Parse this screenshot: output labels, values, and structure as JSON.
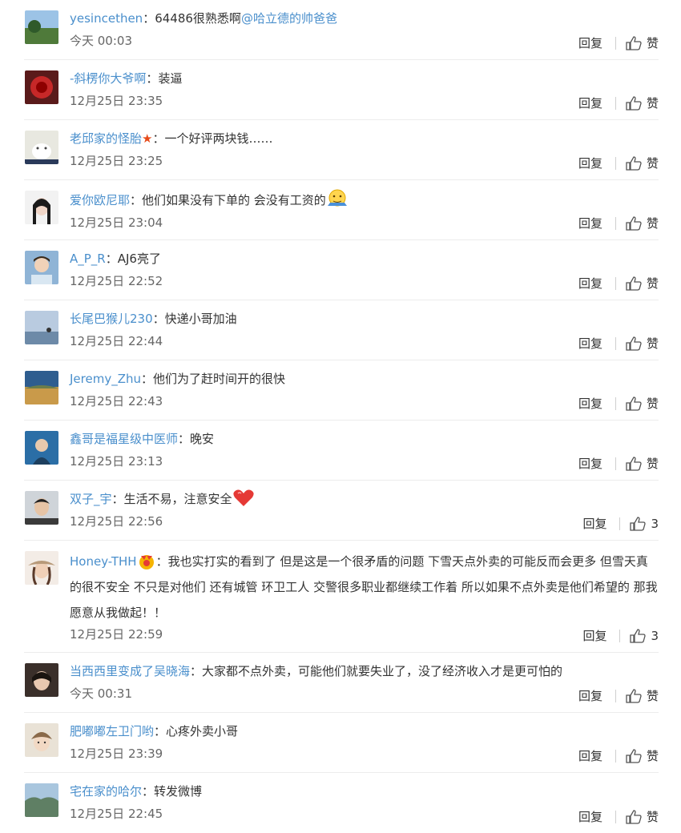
{
  "comments": [
    {
      "user": "yesincethen",
      "sep": "：",
      "text": "64486很熟悉啊",
      "mention": "@哈立德的帅爸爸",
      "time": "今天 00:03",
      "reply": "回复",
      "like": "赞"
    },
    {
      "user": "-斜楞你大爷啊",
      "sep": "：",
      "text": "装逼",
      "time": "12月25日 23:35",
      "reply": "回复",
      "like": "赞"
    },
    {
      "user": "老邱家的怪胎",
      "sep": "：",
      "text": "一个好评两块钱……",
      "time": "12月25日 23:25",
      "reply": "回复",
      "like": "赞",
      "badge": "★"
    },
    {
      "user": "爱你欧尼耶",
      "sep": "：",
      "text": "他们如果没有下单的 会没有工资的",
      "time": "12月25日 23:04",
      "reply": "回复",
      "like": "赞"
    },
    {
      "user": "A_P_R",
      "sep": "：",
      "text": "AJ6亮了",
      "time": "12月25日 22:52",
      "reply": "回复",
      "like": "赞"
    },
    {
      "user": "长尾巴猴儿230",
      "sep": "：",
      "text": "快递小哥加油",
      "time": "12月25日 22:44",
      "reply": "回复",
      "like": "赞"
    },
    {
      "user": "Jeremy_Zhu",
      "sep": "：",
      "text": "他们为了赶时间开的很快",
      "time": "12月25日 22:43",
      "reply": "回复",
      "like": "赞"
    },
    {
      "user": "鑫哥是福星级中医师",
      "sep": "：",
      "text": "晚安",
      "time": "12月25日 23:13",
      "reply": "回复",
      "like": "赞"
    },
    {
      "user": "双子_宇",
      "sep": "：",
      "text": "生活不易，注意安全",
      "time": "12月25日 22:56",
      "reply": "回复",
      "like": "3"
    },
    {
      "user": "Honey-THH",
      "sep": "：",
      "text": "我也实打实的看到了 但是这是一个很矛盾的问题 下雪天点外卖的可能反而会更多 但雪天真的很不安全 不只是对他们 还有城管 环卫工人 交警很多职业都继续工作着 所以如果不点外卖是他们希望的 那我愿意从我做起！！",
      "time": "12月25日 22:59",
      "reply": "回复",
      "like": "3"
    },
    {
      "user": "当西西里变成了吴晓海",
      "sep": "：",
      "text": "大家都不点外卖，可能他们就要失业了，没了经济收入才是更可怕的",
      "time": "今天 00:31",
      "reply": "回复",
      "like": "赞"
    },
    {
      "user": "肥嘟嘟左卫门哟",
      "sep": "：",
      "text": "心疼外卖小哥",
      "time": "12月25日 23:39",
      "reply": "回复",
      "like": "赞"
    },
    {
      "user": "宅在家的哈尔",
      "sep": "：",
      "text": "转发微博",
      "time": "12月25日 22:45",
      "reply": "回复",
      "like": "赞"
    }
  ]
}
